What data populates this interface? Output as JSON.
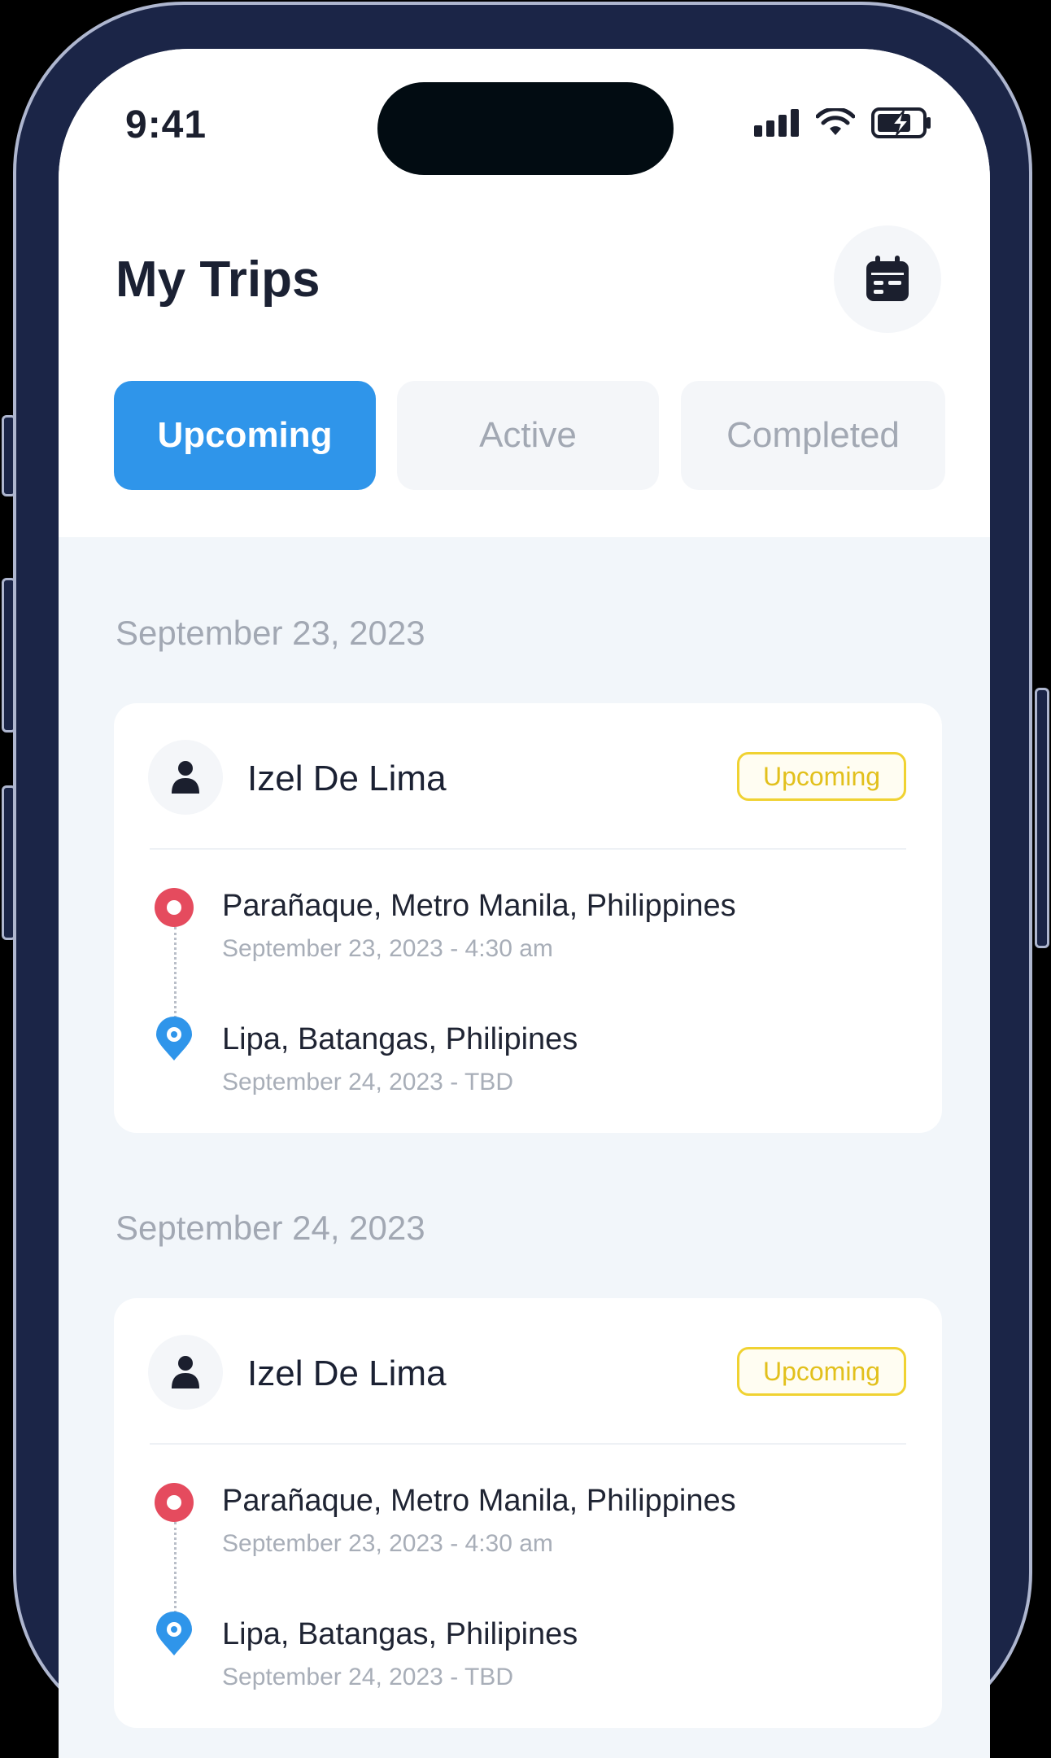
{
  "status_bar": {
    "time": "9:41"
  },
  "header": {
    "title": "My Trips",
    "calendar_icon": "calendar-icon"
  },
  "tabs": [
    {
      "label": "Upcoming",
      "active": true
    },
    {
      "label": "Active",
      "active": false
    },
    {
      "label": "Completed",
      "active": false
    }
  ],
  "colors": {
    "accent": "#2f95ea",
    "badge_yellow": "#f0d232",
    "origin_pin": "#e54b5e",
    "destination_pin": "#2f95ea"
  },
  "sections": [
    {
      "date": "September 23, 2023",
      "trip": {
        "driver": "Izel De Lima",
        "status": "Upcoming",
        "origin": {
          "name": "Parañaque, Metro Manila, Philippines",
          "time": "September 23, 2023 - 4:30 am"
        },
        "destination": {
          "name": "Lipa, Batangas, Philipines",
          "time": "September 24, 2023 - TBD"
        }
      }
    },
    {
      "date": "September 24, 2023",
      "trip": {
        "driver": "Izel De Lima",
        "status": "Upcoming",
        "origin": {
          "name": "Parañaque, Metro Manila, Philippines",
          "time": "September 23, 2023 - 4:30 am"
        },
        "destination": {
          "name": "Lipa, Batangas, Philipines",
          "time": "September 24, 2023 - TBD"
        }
      }
    }
  ]
}
